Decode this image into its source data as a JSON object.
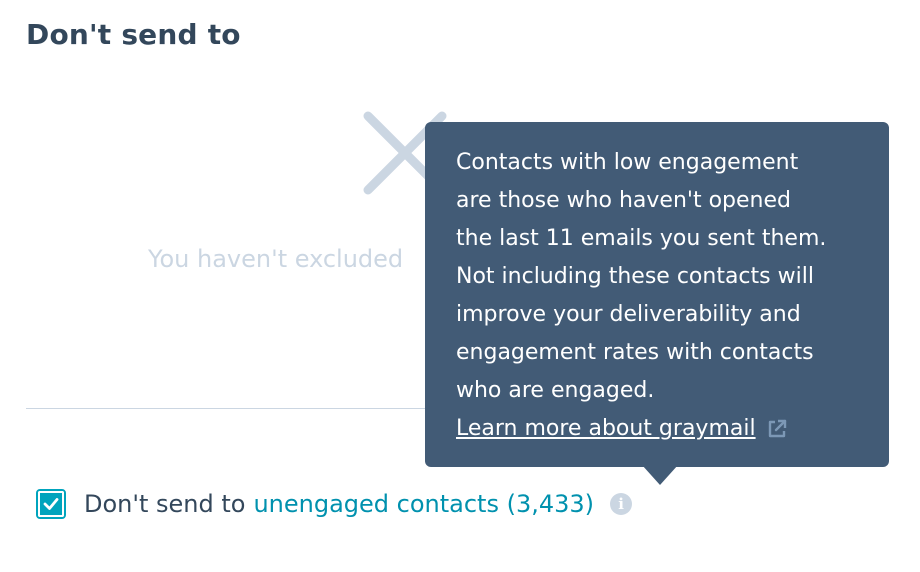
{
  "section": {
    "title": "Don't send to"
  },
  "empty_state": {
    "text": "You haven't excluded"
  },
  "exclusion": {
    "checked": true,
    "label": "Don't send to",
    "link_text": "unengaged contacts (3,433)",
    "info_icon": "info-icon"
  },
  "tooltip": {
    "body": "Contacts with low engagement\nare those who haven't opened\nthe last 11 emails you sent them.\nNot including these contacts will\nimprove your deliverability and\nengagement rates with contacts\nwho are engaged.",
    "link_text": "Learn more about graymail",
    "link_icon": "external-link-icon"
  },
  "colors": {
    "heading": "#33475b",
    "muted": "#cbd6e2",
    "accent": "#00a4bd",
    "link": "#0091ae",
    "tooltip_bg": "#425b76"
  }
}
